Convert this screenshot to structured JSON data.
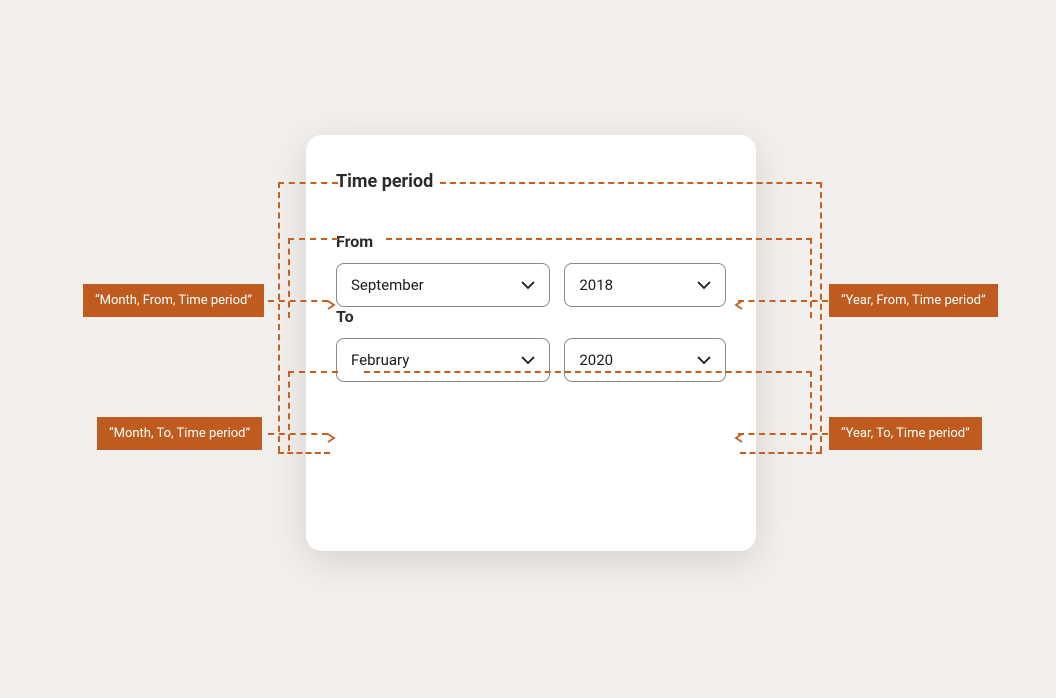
{
  "card": {
    "title": "Time period",
    "from": {
      "label": "From",
      "month": "September",
      "year": "2018"
    },
    "to": {
      "label": "To",
      "month": "February",
      "year": "2020"
    }
  },
  "annotations": {
    "from_month": "“Month, From, Time period”",
    "from_year": "“Year, From, Time period”",
    "to_month": "“Month, To, Time period”",
    "to_year": "“Year, To, Time period”"
  },
  "colors": {
    "accent": "#c65f1f",
    "badge": "#bf5b1e"
  }
}
